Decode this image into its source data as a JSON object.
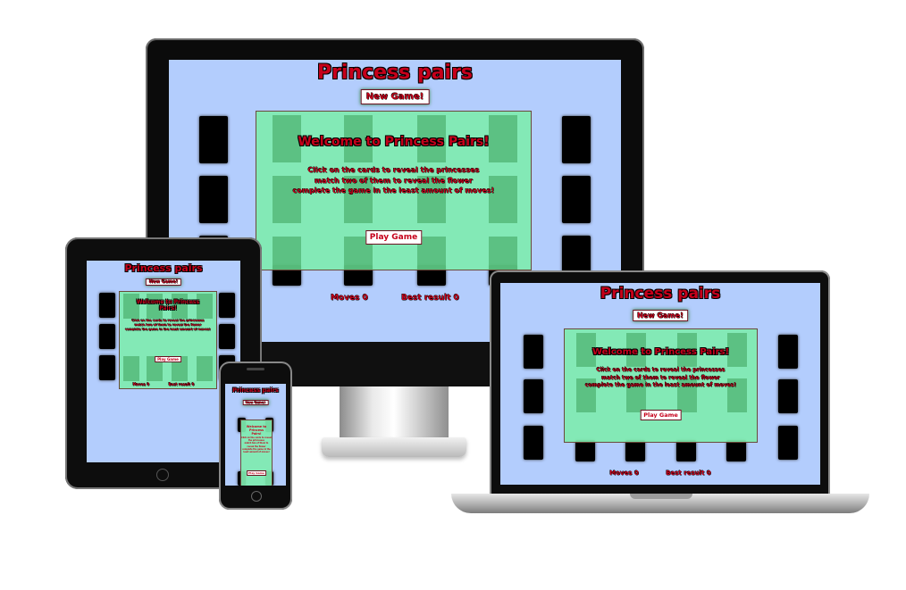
{
  "app": {
    "title": "Princess pairs",
    "new_game_label": "New Game!",
    "play_game_label": "Play Game",
    "moves_label": "Moves 0",
    "best_result_label": "Best result 0"
  },
  "modal": {
    "title": "Welcome to Princess Pairs!",
    "lines": [
      "Click on the cards to reveal the princesses",
      "match two of them to reveal the flower",
      "complete the game in the least amount of moves!"
    ]
  },
  "phone_modal": {
    "title": "Welcome to Princess Pairs!"
  },
  "colors": {
    "background": "#b3cdfd",
    "title_red": "#c6001b",
    "modal_green": "#7fecb0",
    "card_back": "#000000"
  },
  "devices": [
    "monitor",
    "tablet",
    "laptop",
    "phone"
  ]
}
